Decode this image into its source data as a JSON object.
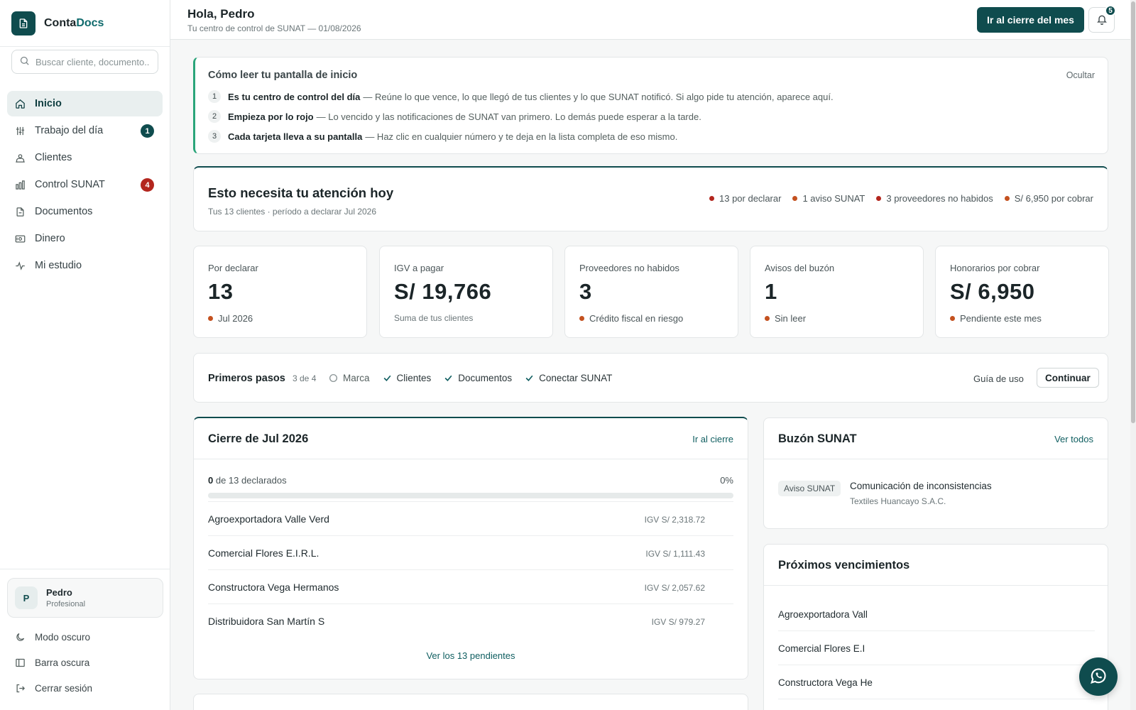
{
  "brand": {
    "name_a": "Conta",
    "name_b": "Docs"
  },
  "search": {
    "placeholder": "Buscar cliente, documento..."
  },
  "nav": [
    {
      "label": "Inicio",
      "icon": "home-icon"
    },
    {
      "label": "Trabajo del día",
      "icon": "sliders-icon",
      "badge": "1"
    },
    {
      "label": "Clientes",
      "icon": "users-icon"
    },
    {
      "label": "Control SUNAT",
      "icon": "bar-chart-icon",
      "badge": "4"
    },
    {
      "label": "Documentos",
      "icon": "document-icon"
    },
    {
      "label": "Dinero",
      "icon": "money-icon"
    },
    {
      "label": "Mi estudio",
      "icon": "activity-icon"
    }
  ],
  "user": {
    "initial": "P",
    "name": "Pedro",
    "role": "Profesional"
  },
  "bottom_links": {
    "dark_mode": "Modo oscuro",
    "dark_bar": "Barra oscura",
    "logout": "Cerrar sesión"
  },
  "header": {
    "greeting": "Hola, Pedro",
    "subtitle": "Tu centro de control de SUNAT — 01/08/2026",
    "cta": "Ir al cierre del mes",
    "notifications": "5"
  },
  "guide": {
    "title": "Cómo leer tu pantalla de inicio",
    "hide": "Ocultar",
    "steps": [
      {
        "n": "1",
        "bold": "Es tu centro de control del día",
        "text": "— Reúne lo que vence, lo que llegó de tus clientes y lo que SUNAT notificó. Si algo pide tu atención, aparece aquí."
      },
      {
        "n": "2",
        "bold": "Empieza por lo rojo",
        "text": "— Lo vencido y las notificaciones de SUNAT van primero. Lo demás puede esperar a la tarde."
      },
      {
        "n": "3",
        "bold": "Cada tarjeta lleva a su pantalla",
        "text": "— Haz clic en cualquier número y te deja en la lista completa de eso mismo."
      }
    ]
  },
  "attention": {
    "title": "Esto necesita tu atención hoy",
    "subtitle": "Tus 13 clientes · período a declarar Jul 2026",
    "pills": [
      "13 por declarar",
      "1 aviso SUNAT",
      "3 proveedores no habidos",
      "S/ 6,950 por cobrar"
    ]
  },
  "kpis": [
    {
      "label": "Por declarar",
      "value": "13",
      "foot": "Jul 2026",
      "dot": true
    },
    {
      "label": "IGV a pagar",
      "value": "S/ 19,766",
      "foot": "Suma de tus clientes",
      "dot": false
    },
    {
      "label": "Proveedores no habidos",
      "value": "3",
      "foot": "Crédito fiscal en riesgo",
      "dot": true
    },
    {
      "label": "Avisos del buzón",
      "value": "1",
      "foot": "Sin leer",
      "dot": true
    },
    {
      "label": "Honorarios por cobrar",
      "value": "S/ 6,950",
      "foot": "Pendiente este mes",
      "dot": true
    }
  ],
  "first_steps": {
    "title": "Primeros pasos",
    "count": "3 de 4",
    "items": [
      {
        "label": "Marca",
        "done": false
      },
      {
        "label": "Clientes",
        "done": true
      },
      {
        "label": "Documentos",
        "done": true
      },
      {
        "label": "Conectar SUNAT",
        "done": true
      }
    ],
    "guide_link": "Guía de uso",
    "continue": "Continuar"
  },
  "cierre": {
    "title": "Cierre de Jul 2026",
    "link": "Ir al cierre",
    "declared": "0",
    "declared_text": "de 13 declarados",
    "percent_label": "0%",
    "progress": 0,
    "rows": [
      {
        "name": "Agroexportadora Valle Verd",
        "igv": "IGV S/ 2,318.72"
      },
      {
        "name": "Comercial Flores E.I.R.L.",
        "igv": "IGV S/ 1,111.43"
      },
      {
        "name": "Constructora Vega Hermanos",
        "igv": "IGV S/ 2,057.62"
      },
      {
        "name": "Distribuidora San Martín S",
        "igv": "IGV S/ 979.27"
      }
    ],
    "see_all": "Ver los 13 pendientes"
  },
  "buzon": {
    "title": "Buzón SUNAT",
    "link": "Ver todos",
    "tag": "Aviso SUNAT",
    "notif_title": "Comunicación de inconsistencias",
    "notif_sub": "Textiles Huancayo S.A.C."
  },
  "vencimientos": {
    "title": "Próximos vencimientos",
    "rows": [
      "Agroexportadora Vall",
      "Comercial Flores E.I",
      "Constructora Vega He"
    ]
  },
  "colors": {
    "brand": "#0f4c4e",
    "accent_green": "#2aa57a",
    "alert_orange": "#c4511f",
    "alert_red": "#b3261e"
  }
}
